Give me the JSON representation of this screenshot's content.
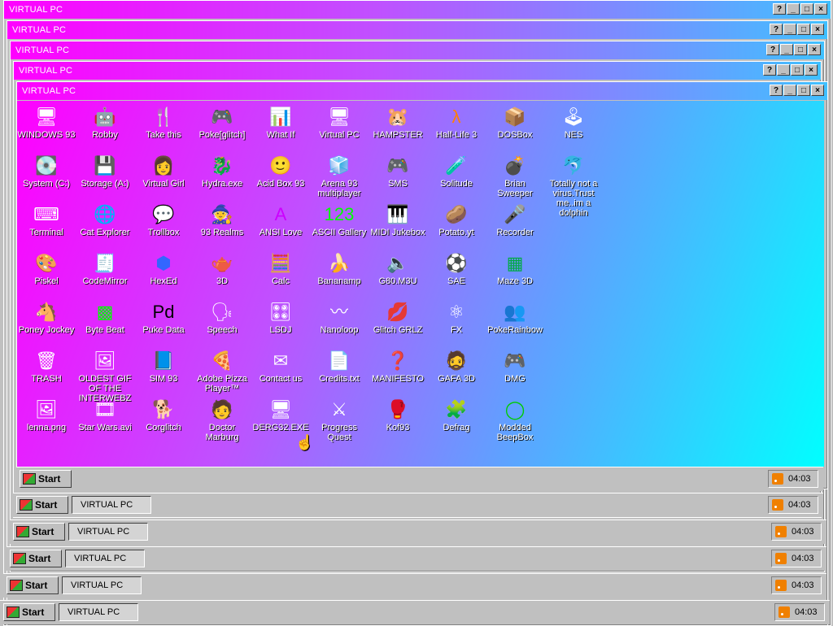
{
  "window_title": "VIRTUAL PC",
  "title_buttons": {
    "help": "?",
    "minimize": "_",
    "maximize": "□",
    "close": "×"
  },
  "taskbar": {
    "start_label": "Start",
    "task_label": "VIRTUAL PC",
    "clock": "04:03"
  },
  "icons": [
    {
      "label": "WINDOWS 93",
      "glyph": "🖥",
      "color": "#fff"
    },
    {
      "label": "Robby",
      "glyph": "🤖",
      "color": "#fff"
    },
    {
      "label": "Take this",
      "glyph": "🍴",
      "color": "#fff"
    },
    {
      "label": "Poke[glitch]",
      "glyph": "🎮",
      "color": "#fff"
    },
    {
      "label": "What If",
      "glyph": "📊",
      "color": "#fff"
    },
    {
      "label": "Virtual PC",
      "glyph": "🖥",
      "color": "#fff"
    },
    {
      "label": "HAMPSTER",
      "glyph": "🐹",
      "color": "#fff"
    },
    {
      "label": "Half-Life 3",
      "glyph": "λ",
      "color": "#ff8000"
    },
    {
      "label": "DOSBox",
      "glyph": "📦",
      "color": "#fff"
    },
    {
      "label": "NES",
      "glyph": "🕹",
      "color": "#fff"
    },
    {
      "label": "System (C:)",
      "glyph": "💽",
      "color": "#fff"
    },
    {
      "label": "Storage (A:)",
      "glyph": "💾",
      "color": "#fff"
    },
    {
      "label": "Virtual Girl",
      "glyph": "👩",
      "color": "#fff"
    },
    {
      "label": "Hydra.exe",
      "glyph": "🐉",
      "color": "#fff"
    },
    {
      "label": "Acid Box 93",
      "glyph": "🙂",
      "color": "#fff"
    },
    {
      "label": "Arena 93 multiplayer",
      "glyph": "🧊",
      "color": "#fff"
    },
    {
      "label": "SMS",
      "glyph": "🎮",
      "color": "#fff"
    },
    {
      "label": "Solitude",
      "glyph": "🧪",
      "color": "#fff"
    },
    {
      "label": "Brian Sweeper",
      "glyph": "💣",
      "color": "#fff"
    },
    {
      "label": "Totally not a virus.Trust me..im a dolphin",
      "glyph": "🐬",
      "color": "#fff"
    },
    {
      "label": "Terminal",
      "glyph": "⌨",
      "color": "#fff"
    },
    {
      "label": "Cat Explorer",
      "glyph": "🌐",
      "color": "#fff"
    },
    {
      "label": "Trollbox",
      "glyph": "💬",
      "color": "#fff"
    },
    {
      "label": "93 Realms",
      "glyph": "🧙",
      "color": "#fff"
    },
    {
      "label": "ANSI Love",
      "glyph": "A",
      "color": "#c0f"
    },
    {
      "label": "ASCII Gallery",
      "glyph": "123",
      "color": "#0f0"
    },
    {
      "label": "MIDI Jukebox",
      "glyph": "🎹",
      "color": "#fff"
    },
    {
      "label": "Potato.yt",
      "glyph": "🥔",
      "color": "#fff"
    },
    {
      "label": "Recorder",
      "glyph": "🎤",
      "color": "#fff"
    },
    {
      "label": "",
      "glyph": "",
      "color": "#fff"
    },
    {
      "label": "Piskel",
      "glyph": "🎨",
      "color": "#fff"
    },
    {
      "label": "CodeMirror",
      "glyph": "🧾",
      "color": "#fff"
    },
    {
      "label": "HexEd",
      "glyph": "⬢",
      "color": "#36f"
    },
    {
      "label": "3D",
      "glyph": "🫖",
      "color": "#fff"
    },
    {
      "label": "Calc",
      "glyph": "🧮",
      "color": "#fff"
    },
    {
      "label": "Bananamp",
      "glyph": "🍌",
      "color": "#fff"
    },
    {
      "label": "G80.M3U",
      "glyph": "🔈",
      "color": "#fff"
    },
    {
      "label": "SAE",
      "glyph": "⚽",
      "color": "#fff"
    },
    {
      "label": "Maze 3D",
      "glyph": "▦",
      "color": "#0a4"
    },
    {
      "label": "",
      "glyph": "",
      "color": "#fff"
    },
    {
      "label": "Poney Jockey",
      "glyph": "🐴",
      "color": "#fff"
    },
    {
      "label": "Byte Beat",
      "glyph": "▩",
      "color": "#0f0"
    },
    {
      "label": "Puke Data",
      "glyph": "Pd",
      "color": "#000"
    },
    {
      "label": "Speech",
      "glyph": "🗣",
      "color": "#fff"
    },
    {
      "label": "LSDJ",
      "glyph": "🎛",
      "color": "#fff"
    },
    {
      "label": "Nanoloop",
      "glyph": "〰",
      "color": "#fff"
    },
    {
      "label": "Glitch GRLZ",
      "glyph": "💋",
      "color": "#fff"
    },
    {
      "label": "FX",
      "glyph": "⚛",
      "color": "#fff"
    },
    {
      "label": "PokeRainbow",
      "glyph": "👥",
      "color": "#fff"
    },
    {
      "label": "",
      "glyph": "",
      "color": "#fff"
    },
    {
      "label": "TRASH",
      "glyph": "🗑",
      "color": "#fff"
    },
    {
      "label": "OLDEST GIF OF THE INTERWEBZ",
      "glyph": "🖼",
      "color": "#fff"
    },
    {
      "label": "SIM 93",
      "glyph": "📘",
      "color": "#fff"
    },
    {
      "label": "Adobe Pizza Player™",
      "glyph": "🍕",
      "color": "#fff"
    },
    {
      "label": "Contact us",
      "glyph": "✉",
      "color": "#fff"
    },
    {
      "label": "Credits.txt",
      "glyph": "📄",
      "color": "#fff"
    },
    {
      "label": "MANIFESTO",
      "glyph": "❓",
      "color": "#fff"
    },
    {
      "label": "GAFA 3D",
      "glyph": "🧔",
      "color": "#fff"
    },
    {
      "label": "DMG",
      "glyph": "🎮",
      "color": "#fff"
    },
    {
      "label": "",
      "glyph": "",
      "color": "#fff"
    },
    {
      "label": "lenna.png",
      "glyph": "🖼",
      "color": "#fff"
    },
    {
      "label": "Star Wars.avi",
      "glyph": "🎞",
      "color": "#fff"
    },
    {
      "label": "Corglitch",
      "glyph": "🐕",
      "color": "#fff"
    },
    {
      "label": "Doctor Marburg",
      "glyph": "🧑",
      "color": "#fff"
    },
    {
      "label": "DERG32.EXE",
      "glyph": "🖥",
      "color": "#fff"
    },
    {
      "label": "Progress Quest",
      "glyph": "⚔",
      "color": "#fff"
    },
    {
      "label": "Kof93",
      "glyph": "🥊",
      "color": "#fff"
    },
    {
      "label": "Defrag",
      "glyph": "🧩",
      "color": "#fff"
    },
    {
      "label": "Modded BeepBox",
      "glyph": "◯",
      "color": "#0c0"
    },
    {
      "label": "",
      "glyph": "",
      "color": "#fff"
    }
  ]
}
